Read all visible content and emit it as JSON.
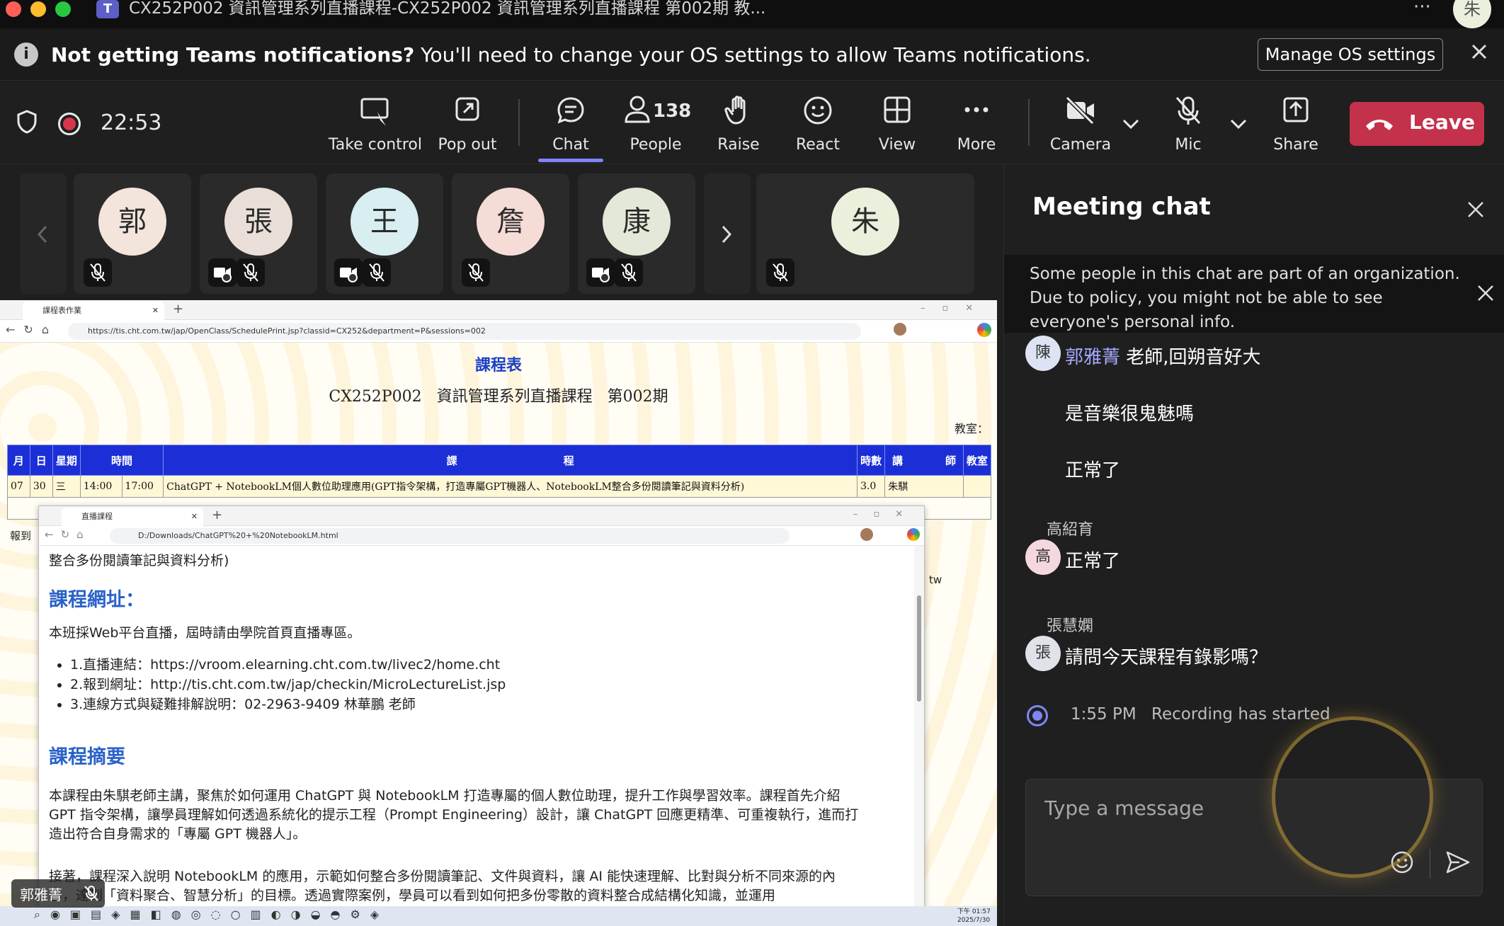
{
  "window": {
    "title": "CX252P002  資訊管理系列直播課程-CX252P002  資訊管理系列直播課程  第002期 教..."
  },
  "notification": {
    "bold": "Not getting Teams notifications?",
    "text": " You'll need to change your OS settings to allow Teams notifications.",
    "button": "Manage OS settings"
  },
  "toolbar": {
    "timer": "22:53",
    "take_control": "Take control",
    "pop_out": "Pop out",
    "chat": "Chat",
    "people": "People",
    "people_count": "138",
    "raise": "Raise",
    "react": "React",
    "view": "View",
    "more": "More",
    "camera": "Camera",
    "mic": "Mic",
    "share": "Share",
    "leave": "Leave"
  },
  "participants": [
    {
      "initial": "郭",
      "color": "#f3e4dc"
    },
    {
      "initial": "張",
      "color": "#eadfd8"
    },
    {
      "initial": "王",
      "color": "#d8eef1"
    },
    {
      "initial": "詹",
      "color": "#f6dcd6"
    },
    {
      "initial": "康",
      "color": "#e3e8d8"
    },
    {
      "initial": "朱",
      "color": "#eaf0dc"
    }
  ],
  "shared": {
    "tab_title": "課程表作業",
    "url": "https://tis.cht.com.tw/jap/OpenClass/SchedulePrint.jsp?classid=CX252&department=P&sessions=002",
    "title": "課程表",
    "subtitle": "CX252P002  資訊管理系列直播課程  第002期",
    "room_label": "教室：",
    "report_label": "報到",
    "tw_label": "tw",
    "table_headers": [
      "月",
      "日",
      "星期",
      "時間",
      "課　　　　　　　　　　程",
      "時數",
      "講　　　　師",
      "教室"
    ],
    "row": [
      "07",
      "30",
      "三",
      "14:00",
      "17:00",
      "ChatGPT + NotebookLM個人數位助理應用(GPT指令架構，打造專屬GPT機器人、NotebookLM整合多份閱讀筆記與資料分析)",
      "3.0",
      "朱騏",
      ""
    ],
    "inner": {
      "tab_title": "直播課程",
      "url": "D:/Downloads/ChatGPT%20+%20NotebookLM.html",
      "scroll_text": "整合多份閱讀筆記與資料分析)",
      "h1": "課程網址：",
      "p1": "本班採Web平台直播，屆時請由學院首頁直播專區。",
      "links": [
        "1.直播連結：https://vroom.elearning.cht.com.tw/livec2/home.cht",
        "2.報到網址：http://tis.cht.com.tw/jap/checkin/MicroLectureList.jsp",
        "3.連線方式與疑難排解說明：02-2963-9409 林華鵬 老師"
      ],
      "h2": "課程摘要",
      "p2a": "本課程由朱騏老師主講，聚焦於如何運用 ChatGPT 與 NotebookLM 打造專屬的個人數位助理，提升工作與學習效率。課程首先介紹",
      "p2b": "GPT 指令架構，讓學員理解如何透過系統化的提示工程（Prompt Engineering）設計，讓 ChatGPT 回應更精準、可重複執行，進而打",
      "p2c": "造出符合自身需求的「專屬 GPT 機器人」。",
      "p3a": "接著，課程深入說明 NotebookLM 的應用，示範如何整合多份閱讀筆記、文件與資料，讓 AI 能快速理解、比對與分析不同來源的內",
      "p3b": "容，達到「資料聚合、智慧分析」的目標。透過實際案例，學員可以看到如何把多份零散的資料整合成結構化知識，並運用"
    },
    "speaker_name": "郭雅菁",
    "clock_time": "下午 01:57",
    "clock_date": "2025/7/30"
  },
  "chat": {
    "title": "Meeting chat",
    "policy": "Some people in this chat are part of an organization. Due to policy, you might not be able to see everyone's personal info.",
    "messages": [
      {
        "avatar": "陳",
        "sender": "郭雅菁",
        "text": "老師,回朔音好大"
      },
      {
        "text": "是音樂很鬼魅嗎"
      },
      {
        "text": "正常了"
      },
      {
        "avatar": "高",
        "sender": "高紹育",
        "text": "正常了"
      },
      {
        "avatar": "張",
        "sender": "張慧嫻",
        "text": "請問今天課程有錄影嗎？"
      }
    ],
    "system_time": "1:55 PM",
    "system_text": "Recording has started",
    "compose_placeholder": "Type a message"
  },
  "colors": {
    "leave": "#c4314b",
    "accent": "#7f85f5",
    "sender_link": "#a6a9ff"
  }
}
